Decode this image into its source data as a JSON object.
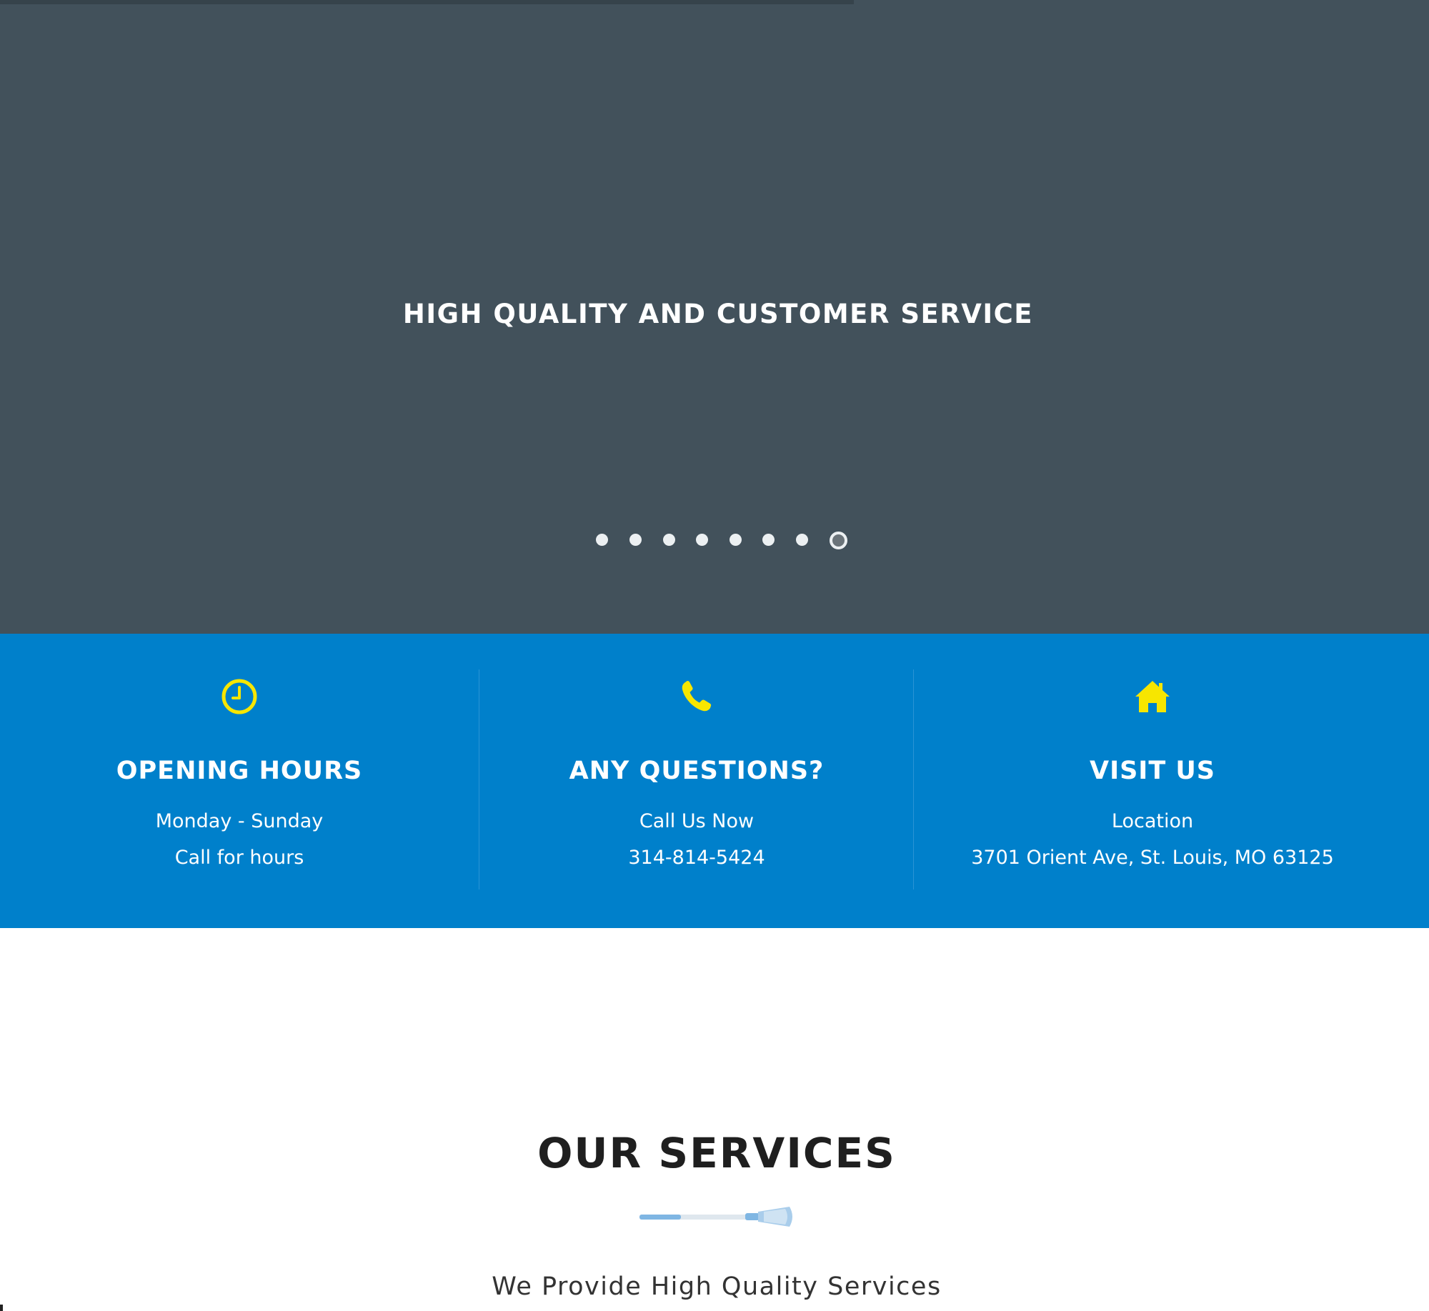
{
  "hero": {
    "title": "HIGH QUALITY AND CUSTOMER SERVICE",
    "slide_count": 8,
    "active_slide": 8,
    "background_color": "#42515b"
  },
  "info_bar": {
    "background_color": "#0080cb",
    "icon_color": "#f7e600",
    "columns": [
      {
        "icon": "clock-icon",
        "title": "OPENING HOURS",
        "line1": "Monday - Sunday",
        "line2": "Call for hours"
      },
      {
        "icon": "phone-icon",
        "title": "ANY QUESTIONS?",
        "line1": "Call Us Now",
        "line2": "314-814-5424"
      },
      {
        "icon": "home-icon",
        "title": "VISIT US",
        "line1": "Location",
        "line2": "3701 Orient Ave, St. Louis, MO 63125"
      }
    ]
  },
  "services": {
    "title": "OUR SERVICES",
    "divider_icon": "broom-icon",
    "subtitle": "We Provide High Quality Services"
  }
}
